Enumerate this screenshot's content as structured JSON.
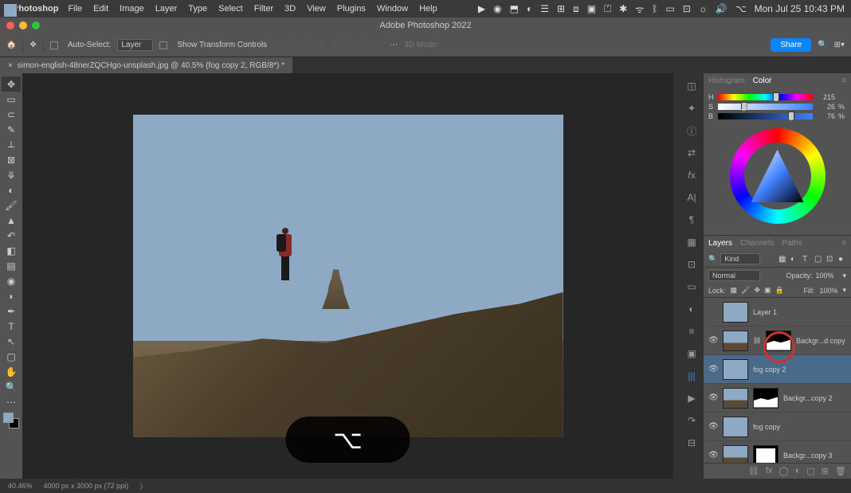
{
  "menubar": {
    "app": "Photoshop",
    "items": [
      "File",
      "Edit",
      "Image",
      "Layer",
      "Type",
      "Select",
      "Filter",
      "3D",
      "View",
      "Plugins",
      "Window",
      "Help"
    ],
    "datetime": "Mon Jul 25  10:43 PM"
  },
  "window": {
    "title": "Adobe Photoshop 2022"
  },
  "options": {
    "auto_select": "Auto-Select:",
    "layer_mode": "Layer",
    "show_transform": "Show Transform Controls",
    "mode_3d": "3D Mode:",
    "share": "Share"
  },
  "tab": {
    "title": "simon-english-48nerZQCHgo-unsplash.jpg @ 40.5% (fog copy 2, RGB/8*) *"
  },
  "color_panel": {
    "tabs": [
      "Histogram",
      "Color"
    ],
    "h": {
      "label": "H",
      "value": "215",
      "unit": ""
    },
    "s": {
      "label": "S",
      "value": "26",
      "unit": "%"
    },
    "b": {
      "label": "B",
      "value": "76",
      "unit": "%"
    }
  },
  "layers_panel": {
    "tabs": [
      "Layers",
      "Channels",
      "Paths"
    ],
    "kind": "Kind",
    "blend": "Normal",
    "opacity_label": "Opacity:",
    "opacity": "100%",
    "lock_label": "Lock:",
    "fill_label": "Fill:",
    "fill": "100%",
    "layers": [
      {
        "name": "Layer 1",
        "visible": false,
        "thumb": "fog",
        "mask": null
      },
      {
        "name": "Backgr...d copy",
        "visible": true,
        "thumb": "img",
        "mask": "shape"
      },
      {
        "name": "fog copy 2",
        "visible": true,
        "thumb": "fog",
        "mask": null,
        "selected": true
      },
      {
        "name": "Backgr...copy 2",
        "visible": true,
        "thumb": "img",
        "mask": "shape"
      },
      {
        "name": "fog copy",
        "visible": true,
        "thumb": "fog",
        "mask": null
      },
      {
        "name": "Backgr...copy 3",
        "visible": true,
        "thumb": "img",
        "mask": "white"
      }
    ]
  },
  "statusbar": {
    "zoom": "40.46%",
    "doc": "4000 px x 3000 px (72 ppi)"
  },
  "key_overlay": "⌥"
}
